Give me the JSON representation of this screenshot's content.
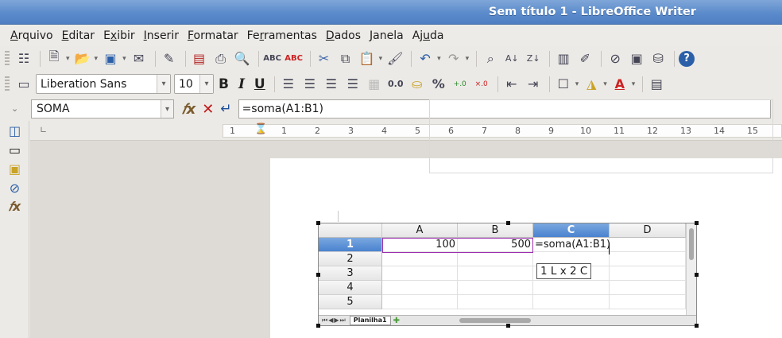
{
  "window": {
    "title": "Sem título 1 - LibreOffice Writer"
  },
  "menu": [
    {
      "pre": "",
      "u": "A",
      "post": "rquivo"
    },
    {
      "pre": "",
      "u": "E",
      "post": "ditar"
    },
    {
      "pre": "E",
      "u": "x",
      "post": "ibir"
    },
    {
      "pre": "",
      "u": "I",
      "post": "nserir"
    },
    {
      "pre": "",
      "u": "F",
      "post": "ormatar"
    },
    {
      "pre": "Fe",
      "u": "r",
      "post": "ramentas"
    },
    {
      "pre": "",
      "u": "D",
      "post": "ados"
    },
    {
      "pre": "",
      "u": "J",
      "post": "anela"
    },
    {
      "pre": "Aj",
      "u": "u",
      "post": "da"
    }
  ],
  "formatting": {
    "font_name": "Liberation Sans",
    "font_size": "10",
    "bold": "B",
    "italic": "I",
    "underline": "U",
    "number_format": "0.0",
    "percent": "%"
  },
  "formula_bar": {
    "name_box": "SOMA",
    "input": "=soma(A1:B1)"
  },
  "ruler": {
    "numbers": [
      "1",
      "1",
      "2",
      "3",
      "4",
      "5",
      "6",
      "7",
      "8",
      "9",
      "10",
      "11",
      "12",
      "13",
      "14",
      "15"
    ]
  },
  "sheet": {
    "columns": [
      "A",
      "B",
      "C",
      "D"
    ],
    "rows": [
      {
        "num": "1",
        "a": "100",
        "b": "500",
        "c": "=soma(A1:B1)",
        "d": ""
      },
      {
        "num": "2",
        "a": "",
        "b": "",
        "c": "",
        "d": ""
      },
      {
        "num": "3",
        "a": "",
        "b": "",
        "c": "",
        "d": ""
      },
      {
        "num": "4",
        "a": "",
        "b": "",
        "c": "",
        "d": ""
      },
      {
        "num": "5",
        "a": "",
        "b": "",
        "c": "",
        "d": ""
      }
    ],
    "tab": "Planilha1",
    "tooltip": "1 L x 2 C"
  },
  "colors": {
    "titlebar": "#5b8bcb",
    "selected_header": "#4a82cf",
    "range_border": "#9b2fb0"
  }
}
